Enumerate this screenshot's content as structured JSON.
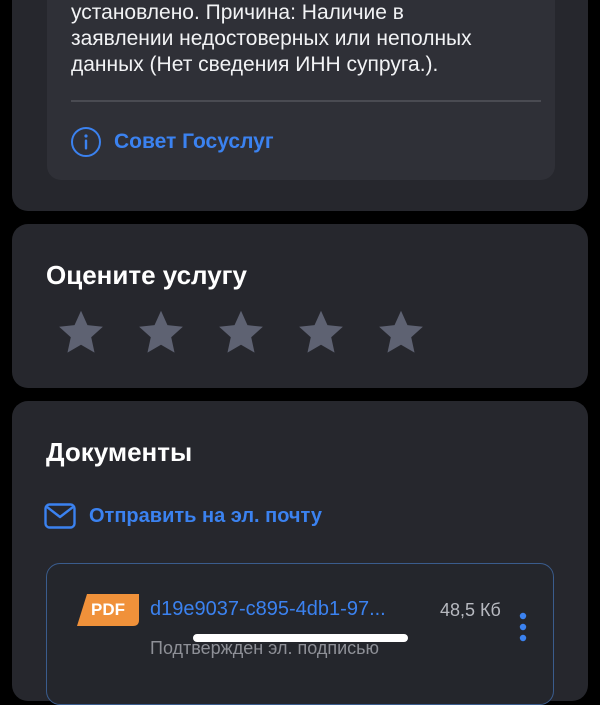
{
  "status_card": {
    "reason_text": "установлено. Причина: Наличие в\nзаявлении недостоверных или неполных\nданных (Нет сведения ИНН супруга.).",
    "advice_label": "Совет Госуслуг"
  },
  "rating": {
    "title": "Оцените услугу",
    "stars_total": 5,
    "stars_selected": 0
  },
  "documents": {
    "title": "Документы",
    "send_email_label": "Отправить на эл. почту",
    "items": [
      {
        "type_badge": "PDF",
        "name": "d19e9037-c895-4db1-97...",
        "size": "48,5 Кб",
        "status": "Подтвержден эл. подписью"
      }
    ]
  },
  "colors": {
    "accent": "#3b82f0",
    "pdf_badge": "#f0913a",
    "star_inactive": "#5e6272",
    "card_bg": "#26272d"
  },
  "icons": {
    "advice": "info-circle-icon",
    "email": "envelope-icon",
    "star": "star-icon",
    "menu": "more-vertical-icon"
  }
}
